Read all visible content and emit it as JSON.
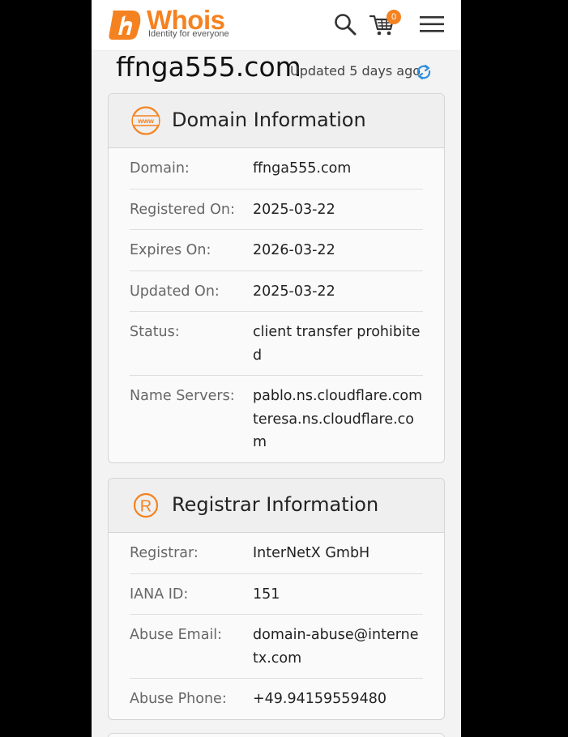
{
  "header": {
    "logo_word": "Whois",
    "logo_tagline": "Identity for everyone",
    "cart_count": "0",
    "icons": [
      "search-icon",
      "cart-icon",
      "hamburger-menu-icon"
    ]
  },
  "title": {
    "domain": "ffnga555.com",
    "updated": "Updated 5 days ago"
  },
  "domain_info": {
    "title": "Domain Information",
    "rows": [
      {
        "label": "Domain:",
        "value": "ffnga555.com"
      },
      {
        "label": "Registered On:",
        "value": "2025-03-22"
      },
      {
        "label": "Expires On:",
        "value": "2026-03-22"
      },
      {
        "label": "Updated On:",
        "value": "2025-03-22"
      },
      {
        "label": "Status:",
        "value": "client transfer prohibited"
      },
      {
        "label": "Name Servers:",
        "value": "pablo.ns.cloudflare.com teresa.ns.cloudflare.com"
      }
    ]
  },
  "registrar_info": {
    "title": "Registrar Information",
    "rows": [
      {
        "label": "Registrar:",
        "value": "InterNetX GmbH"
      },
      {
        "label": "IANA ID:",
        "value": "151"
      },
      {
        "label": "Abuse Email:",
        "value": "domain-abuse@internetx.com"
      },
      {
        "label": "Abuse Phone:",
        "value": "+49.94159559480"
      }
    ]
  },
  "colors": {
    "brand": "#f58220",
    "refresh": "#2f8fe0",
    "background": "#f3f3f3"
  }
}
